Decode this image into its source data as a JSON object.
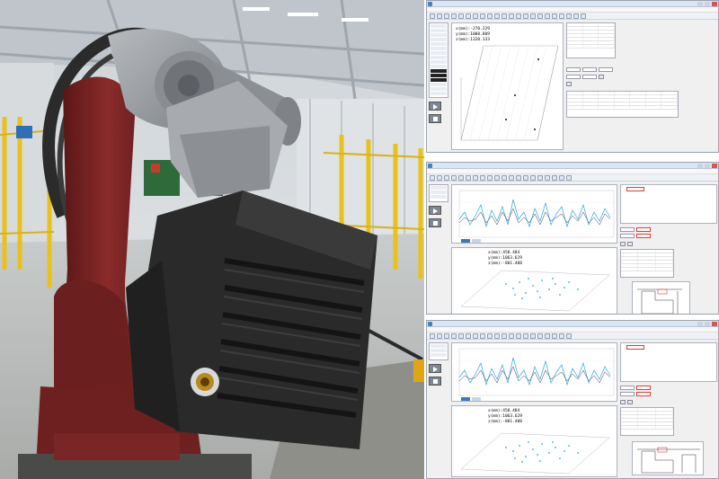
{
  "screens": [
    {
      "coords": [
        "x(mm):-270.229",
        "y(mm):1008.809",
        "z(mm):1320.133"
      ]
    },
    {
      "coords": [
        "x(mm):458.484",
        "y(mm):1063.629",
        "z(mm):-801.408"
      ]
    },
    {
      "coords": [
        "x(mm):458.484",
        "y(mm):1063.629",
        "z(mm):-801.408"
      ]
    }
  ],
  "colors": {
    "robot_red": "#7a2424",
    "robot_gray": "#9a9ea3",
    "shield_black": "#2a2a2a",
    "fence_yellow": "#e8c21a",
    "series_blue": "#2aa8d8",
    "series_dark": "#3a3a5a",
    "highlight_red": "#e23b2e"
  }
}
